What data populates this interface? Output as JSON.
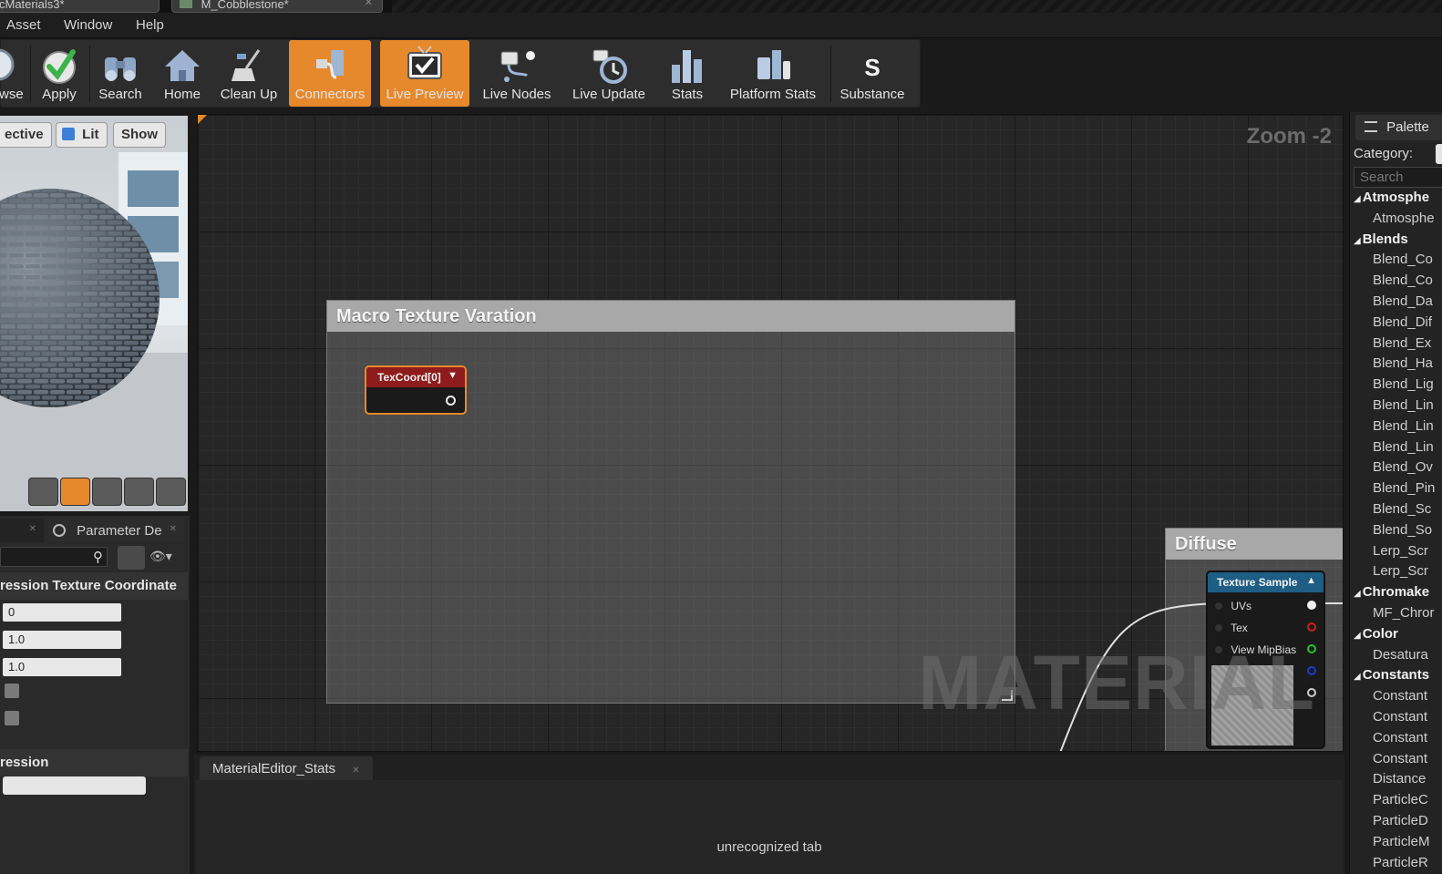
{
  "tabs": [
    {
      "label": "cMaterials3*"
    },
    {
      "label": "M_Cobblestone*"
    }
  ],
  "menu": [
    "Asset",
    "Window",
    "Help"
  ],
  "toolbar": {
    "items": [
      {
        "label": "wse",
        "icon": "browse-icon"
      },
      {
        "label": "Apply",
        "icon": "checkmark-icon"
      },
      {
        "label": "Search",
        "icon": "binoculars-icon"
      },
      {
        "label": "Home",
        "icon": "home-icon"
      },
      {
        "label": "Clean Up",
        "icon": "broom-icon"
      },
      {
        "label": "Connectors",
        "icon": "connectors-icon",
        "active": true
      },
      {
        "label": "Live Preview",
        "icon": "tv-check-icon",
        "active": true
      },
      {
        "label": "Live Nodes",
        "icon": "live-nodes-icon"
      },
      {
        "label": "Live Update",
        "icon": "live-update-icon"
      },
      {
        "label": "Stats",
        "icon": "bar-stats-icon"
      },
      {
        "label": "Platform Stats",
        "icon": "platform-stats-icon"
      },
      {
        "label": "Substance",
        "icon": "substance-icon"
      }
    ]
  },
  "viewport": {
    "perspective_label": "ective",
    "lit_label": "Lit",
    "show_label": "Show"
  },
  "details": {
    "tab_param": "Parameter De",
    "section_title": "ression Texture Coordinate",
    "fields": [
      "0",
      "1.0",
      "1.0"
    ],
    "section2_title": "ression"
  },
  "graph": {
    "zoom": "Zoom -2",
    "comment1_title": "Macro Texture Varation",
    "texcoord_label": "TexCoord[0]",
    "comment2_title": "Diffuse",
    "texture_sample_label": "Texture Sample",
    "pins": [
      "UVs",
      "Tex",
      "View MipBias"
    ],
    "watermark": "MATERIAL"
  },
  "stats": {
    "tab_label": "MaterialEditor_Stats",
    "body_text": "unrecognized tab"
  },
  "palette": {
    "tab_label": "Palette",
    "category_label": "Category:",
    "search_placeholder": "Search",
    "rows": [
      {
        "text": "Atmosphe",
        "cat": true
      },
      {
        "text": "Atmosphe",
        "cat": false
      },
      {
        "text": "Blends",
        "cat": true
      },
      {
        "text": "Blend_Co",
        "cat": false
      },
      {
        "text": "Blend_Co",
        "cat": false
      },
      {
        "text": "Blend_Da",
        "cat": false
      },
      {
        "text": "Blend_Dif",
        "cat": false
      },
      {
        "text": "Blend_Ex",
        "cat": false
      },
      {
        "text": "Blend_Ha",
        "cat": false
      },
      {
        "text": "Blend_Lig",
        "cat": false
      },
      {
        "text": "Blend_Lin",
        "cat": false
      },
      {
        "text": "Blend_Lin",
        "cat": false
      },
      {
        "text": "Blend_Lin",
        "cat": false
      },
      {
        "text": "Blend_Ov",
        "cat": false
      },
      {
        "text": "Blend_Pin",
        "cat": false
      },
      {
        "text": "Blend_Sc",
        "cat": false
      },
      {
        "text": "Blend_So",
        "cat": false
      },
      {
        "text": "Lerp_Scr",
        "cat": false
      },
      {
        "text": "Lerp_Scr",
        "cat": false
      },
      {
        "text": "Chromake",
        "cat": true
      },
      {
        "text": "MF_Chror",
        "cat": false
      },
      {
        "text": "Color",
        "cat": true
      },
      {
        "text": "Desatura",
        "cat": false
      },
      {
        "text": "Constants",
        "cat": true
      },
      {
        "text": "Constant",
        "cat": false
      },
      {
        "text": "Constant",
        "cat": false
      },
      {
        "text": "Constant",
        "cat": false
      },
      {
        "text": "Constant",
        "cat": false
      },
      {
        "text": "Distance",
        "cat": false
      },
      {
        "text": "ParticleC",
        "cat": false
      },
      {
        "text": "ParticleD",
        "cat": false
      },
      {
        "text": "ParticleM",
        "cat": false
      },
      {
        "text": "ParticleR",
        "cat": false
      }
    ]
  },
  "colors": {
    "accent": "#e6892c",
    "node_header_red": "#8e1c1c",
    "node_header_blue": "#1f5e84"
  }
}
